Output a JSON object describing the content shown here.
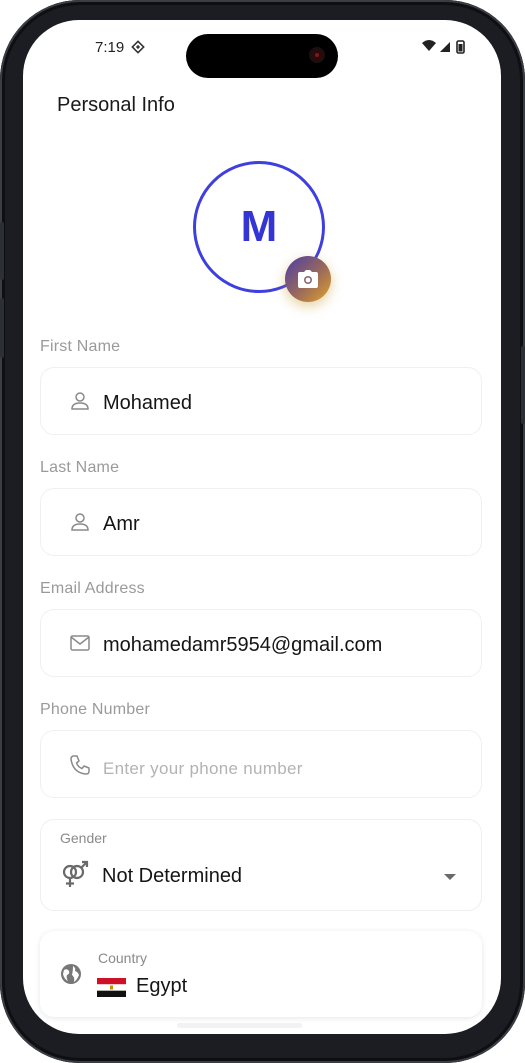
{
  "status_bar": {
    "time": "7:19"
  },
  "page": {
    "title": "Personal Info"
  },
  "avatar": {
    "letter": "M",
    "accent": "#3f3fe0"
  },
  "fields": {
    "first_name": {
      "label": "First Name",
      "value": "Mohamed",
      "icon": "person-icon"
    },
    "last_name": {
      "label": "Last Name",
      "value": "Amr",
      "icon": "person-icon"
    },
    "email": {
      "label": "Email Address",
      "value": "mohamedamr5954@gmail.com",
      "icon": "mail-icon"
    },
    "phone": {
      "label": "Phone Number",
      "placeholder": "Enter your phone number",
      "icon": "phone-icon"
    }
  },
  "gender": {
    "label": "Gender",
    "value": "Not Determined",
    "icon": "gender-icon"
  },
  "country": {
    "label": "Country",
    "value": "Egypt",
    "icon": "globe-icon",
    "flag": "egypt-flag"
  }
}
